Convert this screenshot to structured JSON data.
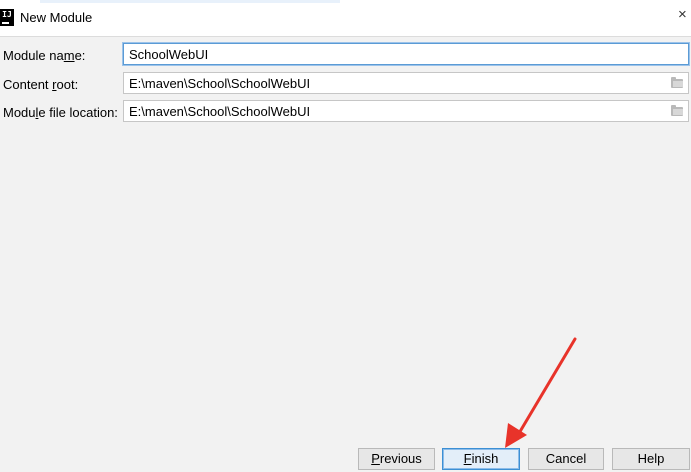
{
  "window": {
    "title": "New Module",
    "app_icon_text": "IJ",
    "close_glyph": "×"
  },
  "form": {
    "module_name": {
      "label_pre": "Module na",
      "label_mn": "m",
      "label_post": "e:",
      "value": "SchoolWebUI"
    },
    "content_root": {
      "label_pre": "Content ",
      "label_mn": "r",
      "label_post": "oot:",
      "value": "E:\\maven\\School\\SchoolWebUI"
    },
    "module_file_location": {
      "label_pre": "Modu",
      "label_mn": "l",
      "label_post": "e file location:",
      "value": "E:\\maven\\School\\SchoolWebUI"
    }
  },
  "buttons": {
    "previous": {
      "mn": "P",
      "rest": "revious"
    },
    "finish": {
      "mn": "F",
      "rest": "inish"
    },
    "cancel": {
      "label": "Cancel"
    },
    "help": {
      "label": "Help"
    }
  },
  "colors": {
    "accent": "#3c8fd4",
    "annotation_arrow": "#e8332a"
  }
}
